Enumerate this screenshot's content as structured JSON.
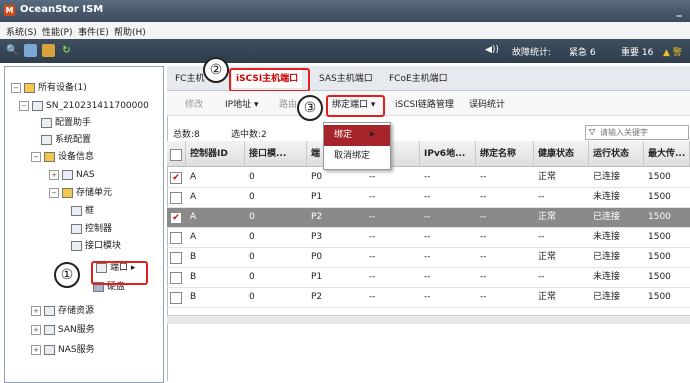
{
  "app": {
    "title": "OceanStor ISM",
    "logo": "M",
    "minimize": "_"
  },
  "menu": [
    "系统(S)",
    "性能(P)",
    "事件(E)",
    "帮助(H)"
  ],
  "toolbar": {
    "icons": [
      "search-icon",
      "monitor-icon",
      "tool-icon",
      "refresh-icon"
    ],
    "sound_icon": "◀))",
    "fault_label": "故障统计:",
    "urgent": "紧急 6",
    "major": "重要 16",
    "warn": "▲ 警"
  },
  "tree": {
    "root": "所有设备(1)",
    "device": "SN_210231411700000",
    "assistant": "配置助手",
    "sysconfig": "系统配置",
    "devinfo": "设备信息",
    "nas": "NAS",
    "storage_unit": "存储单元",
    "frame": "框",
    "controller": "控制器",
    "iface_module": "接口模块",
    "port": "端口",
    "disk": "硬盘",
    "storage_res": "存储资源",
    "san": "SAN服务",
    "nas_service": "NAS服务"
  },
  "tabs": [
    "FC主机",
    "iSCSI主机端口",
    "SAS主机端口",
    "FCoE主机端口"
  ],
  "actions": {
    "modify": "修改",
    "ip": "IP地址 ▾",
    "route": "路由",
    "bind": "绑定端口 ▾",
    "iscsi_link": "iSCSI链路管理",
    "err_stats": "误码统计"
  },
  "dropdown": {
    "bind": "绑定",
    "unbind": "取消绑定"
  },
  "counts": {
    "total": "总数:8",
    "selected": "选中数:2"
  },
  "search": {
    "placeholder": "请输入关键字"
  },
  "callouts": {
    "one": "①",
    "two": "②",
    "three": "③"
  },
  "table": {
    "headers": [
      "控制器ID",
      "接口模...",
      "端",
      "地...",
      "IPv6地...",
      "绑定名称",
      "健康状态",
      "运行状态",
      "最大传..."
    ],
    "rows": [
      {
        "checked": true,
        "selected": false,
        "ctrl": "A",
        "mod": "0",
        "port": "P0",
        "ipv4": "--",
        "ipv6": "--",
        "bind": "--",
        "health": "正常",
        "run": "已连接",
        "mtu": "1500"
      },
      {
        "checked": false,
        "selected": false,
        "ctrl": "A",
        "mod": "0",
        "port": "P1",
        "ipv4": "--",
        "ipv6": "--",
        "bind": "--",
        "health": "--",
        "run": "未连接",
        "mtu": "1500"
      },
      {
        "checked": true,
        "selected": true,
        "ctrl": "A",
        "mod": "0",
        "port": "P2",
        "ipv4": "--",
        "ipv6": "--",
        "bind": "--",
        "health": "正常",
        "run": "已连接",
        "mtu": "1500"
      },
      {
        "checked": false,
        "selected": false,
        "ctrl": "A",
        "mod": "0",
        "port": "P3",
        "ipv4": "--",
        "ipv6": "--",
        "bind": "--",
        "health": "--",
        "run": "未连接",
        "mtu": "1500"
      },
      {
        "checked": false,
        "selected": false,
        "ctrl": "B",
        "mod": "0",
        "port": "P0",
        "ipv4": "--",
        "ipv6": "--",
        "bind": "--",
        "health": "正常",
        "run": "已连接",
        "mtu": "1500"
      },
      {
        "checked": false,
        "selected": false,
        "ctrl": "B",
        "mod": "0",
        "port": "P1",
        "ipv4": "--",
        "ipv6": "--",
        "bind": "--",
        "health": "--",
        "run": "未连接",
        "mtu": "1500"
      },
      {
        "checked": false,
        "selected": false,
        "ctrl": "B",
        "mod": "0",
        "port": "P2",
        "ipv4": "--",
        "ipv6": "--",
        "bind": "--",
        "health": "正常",
        "run": "已连接",
        "mtu": "1500"
      }
    ]
  }
}
